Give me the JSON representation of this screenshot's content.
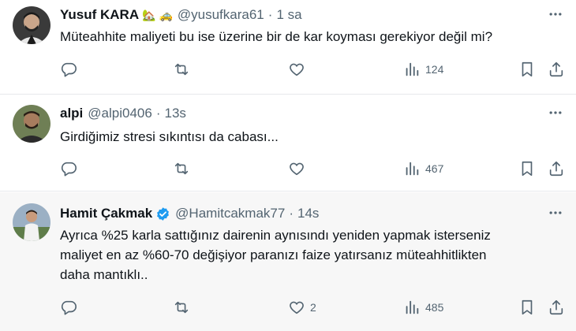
{
  "tweets": [
    {
      "name": "Yusuf KARA",
      "emoji": "🏡 🚕",
      "handle": "@yusufkara61",
      "time": "1 sa",
      "text": "Müteahhite maliyeti bu ise üzerine bir de kar koyması gerekiyor değil mi?",
      "likes": "",
      "views": "124",
      "verified": false
    },
    {
      "name": "alpi",
      "handle": "@alpi0406",
      "time": "13s",
      "text": "Girdiğimiz stresi sıkıntısı da cabası...",
      "likes": "",
      "views": "467",
      "verified": false
    },
    {
      "name": "Hamit Çakmak",
      "handle": "@Hamitcakmak77",
      "time": "14s",
      "text": "Ayrıca %25 karla sattığınız dairenin aynısındı yeniden yapmak isterseniz\nmaliyet en az %60-70 değişiyor paranızı faize yatırsanız müteahhitlikten\ndaha mantıklı..",
      "likes": "2",
      "views": "485",
      "verified": true
    }
  ],
  "icons": {
    "more": "more-icon",
    "reply": "reply-icon",
    "retweet": "retweet-icon",
    "like": "like-icon",
    "views": "views-icon",
    "bookmark": "bookmark-icon",
    "share": "share-icon"
  },
  "colors": {
    "text": "#0f1419",
    "muted": "#536471",
    "verified": "#1d9bf0",
    "highlight_bg": "#f7f7f7",
    "divider": "#e6e9ec"
  },
  "separator": "·"
}
